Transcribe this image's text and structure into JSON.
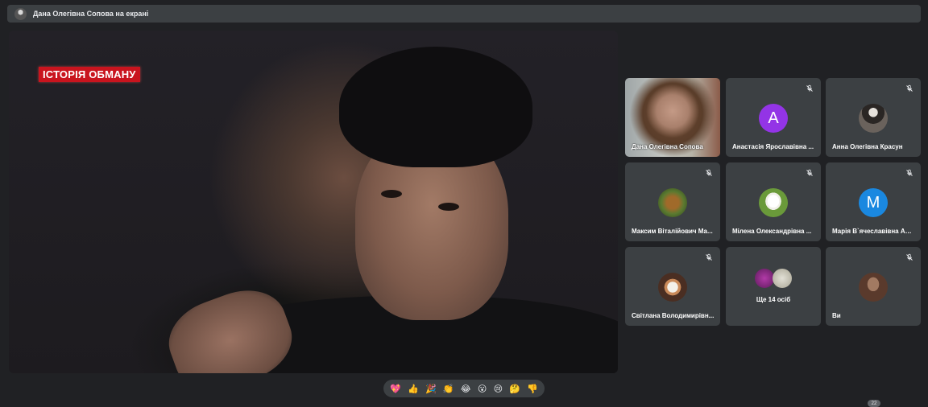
{
  "presenter_bar": {
    "title": "Дана Олегівна Сопова на екрані"
  },
  "main_video": {
    "logo_text": "ІСТОРІЯ ОБМАНУ",
    "logo_color": "#c9141e"
  },
  "participants": [
    {
      "name": "Дана Олегівна Сопова",
      "type": "camera",
      "muted": false
    },
    {
      "name": "Анастасія Ярославівна ...",
      "type": "letter",
      "letter": "A",
      "color": "#9334e6",
      "muted": true
    },
    {
      "name": "Анна Олегівна Красун",
      "type": "photo",
      "icon": "person-photo-icon",
      "muted": true
    },
    {
      "name": "Максим Віталійович Ма...",
      "type": "photo",
      "icon": "painting-face-icon",
      "muted": true
    },
    {
      "name": "Мілена Олександрівна ...",
      "type": "photo",
      "icon": "goose-photo-icon",
      "muted": true
    },
    {
      "name": "Марія В`ячеславівна Аф...",
      "type": "letter",
      "letter": "M",
      "color": "#1a88e0",
      "muted": true
    },
    {
      "name": "Світлана Володимирівн...",
      "type": "photo",
      "icon": "pet-photo-icon",
      "muted": true
    },
    {
      "name": "Ще 14 осіб",
      "type": "more",
      "muted": false
    },
    {
      "name": "Ви",
      "type": "photo",
      "icon": "self-photo-icon",
      "muted": true
    }
  ],
  "reactions": [
    "💖",
    "👍",
    "🎉",
    "👏",
    "😂",
    "😮",
    "😢",
    "🤔",
    "👎"
  ],
  "participant_count_badge": "22",
  "colors": {
    "background": "#202124",
    "tile": "#3c4043",
    "text": "#e8eaed"
  }
}
